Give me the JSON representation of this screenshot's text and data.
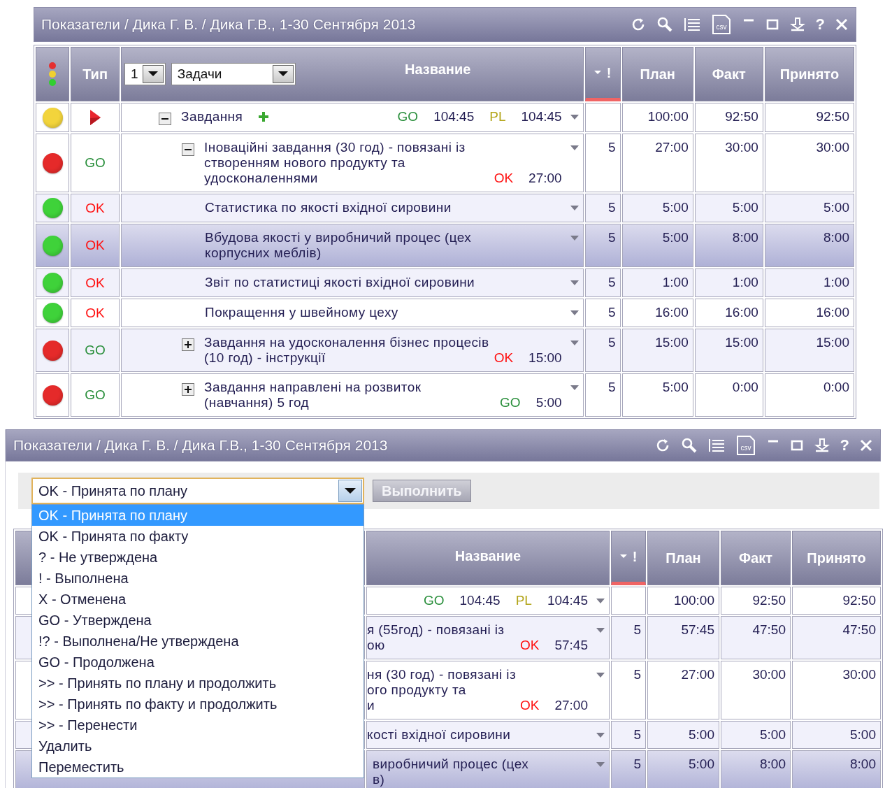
{
  "top_window": {
    "title": "Показатели / Дика Г. В. / Дика Г.В., 1-30 Сентября 2013",
    "toolbar": {
      "export_label": "csv",
      "help_label": "?"
    },
    "table": {
      "level_select": {
        "value": "1"
      },
      "group_select": {
        "value": "Задачи"
      },
      "columns": [
        {
          "kind": "status"
        },
        {
          "kind": "type",
          "label": "Тип"
        },
        {
          "kind": "name",
          "label": "Название"
        },
        {
          "kind": "flag",
          "label": "!",
          "sorted": true
        },
        {
          "kind": "number",
          "label": "План"
        },
        {
          "kind": "number",
          "label": "Факт"
        },
        {
          "kind": "number",
          "label": "Принято"
        }
      ],
      "rows": [
        {
          "color": "#f2d43c",
          "type": {
            "kind": "play"
          },
          "name_lines": [
            "Завдання"
          ],
          "expanded": true,
          "addable": true,
          "tags": [
            {
              "kind": "go",
              "text": "GO"
            },
            {
              "kind": "time",
              "text": "104:45"
            },
            {
              "kind": "pl",
              "text": "PL"
            },
            {
              "kind": "time",
              "text": "104:45"
            }
          ],
          "plan": "100:00",
          "fact": "92:50",
          "accepted": "92:50",
          "shaded": false,
          "selected": false,
          "children": [
            {
              "color": "#e52a2a",
              "type": {
                "kind": "go",
                "text": "GO"
              },
              "name_lines": [
                "Іноваційні завдання (30 год) - повязані із",
                "створенням нового продукту та",
                "удосконаленнями"
              ],
              "expanded": true,
              "tags": [
                {
                  "kind": "ok",
                  "text": "OK"
                },
                {
                  "kind": "time",
                  "text": "27:00"
                }
              ],
              "priority": "5",
              "plan": "27:00",
              "fact": "30:00",
              "accepted": "30:00",
              "shaded": false,
              "selected": false,
              "children": [
                {
                  "color": "#3fd23a",
                  "type": {
                    "kind": "ok",
                    "text": "OK"
                  },
                  "name_lines": [
                    "Статистика по якості вхідної сировини"
                  ],
                  "priority": "5",
                  "plan": "5:00",
                  "fact": "5:00",
                  "accepted": "5:00",
                  "shaded": true,
                  "selected": false
                },
                {
                  "color": "#3fd23a",
                  "type": {
                    "kind": "ok",
                    "text": "OK"
                  },
                  "name_lines": [
                    "Вбудова якості у виробничий процес (цех",
                    "корпусних меблів)"
                  ],
                  "priority": "5",
                  "plan": "5:00",
                  "fact": "8:00",
                  "accepted": "8:00",
                  "selected": true
                },
                {
                  "color": "#3fd23a",
                  "type": {
                    "kind": "ok",
                    "text": "OK"
                  },
                  "name_lines": [
                    "Звіт по статистиці якості вхідної сировини"
                  ],
                  "priority": "5",
                  "plan": "1:00",
                  "fact": "1:00",
                  "accepted": "1:00",
                  "shaded": true,
                  "selected": false
                },
                {
                  "color": "#3fd23a",
                  "type": {
                    "kind": "ok",
                    "text": "OK"
                  },
                  "name_lines": [
                    "Покращення у швейному цеху"
                  ],
                  "priority": "5",
                  "plan": "16:00",
                  "fact": "16:00",
                  "accepted": "16:00",
                  "shaded": false,
                  "selected": false
                }
              ]
            },
            {
              "color": "#e52a2a",
              "type": {
                "kind": "go",
                "text": "GO"
              },
              "name_lines": [
                "Завдання на удосконалення бізнес процесів",
                "(10 год) - інструкції"
              ],
              "expanded": false,
              "tags": [
                {
                  "kind": "ok",
                  "text": "OK"
                },
                {
                  "kind": "time",
                  "text": "15:00"
                }
              ],
              "priority": "5",
              "plan": "15:00",
              "fact": "15:00",
              "accepted": "15:00",
              "shaded": true,
              "selected": false
            },
            {
              "color": "#e52a2a",
              "type": {
                "kind": "go",
                "text": "GO"
              },
              "name_lines": [
                "Завдання направлені на розвиток",
                "(навчання) 5 год"
              ],
              "expanded": false,
              "tags": [
                {
                  "kind": "go",
                  "text": "GO"
                },
                {
                  "kind": "time",
                  "text": "5:00"
                }
              ],
              "priority": "5",
              "plan": "5:00",
              "fact": "0:00",
              "accepted": "0:00",
              "shaded": false,
              "selected": false
            }
          ]
        }
      ]
    }
  },
  "bottom_window": {
    "title": "Показатели / Дика Г. В. / Дика Г.В., 1-30 Сентября 2013",
    "toolbar": {
      "export_label": "csv",
      "help_label": "?"
    },
    "action_select": {
      "value": "OK - Принята по плану",
      "open": true
    },
    "execute_button": {
      "label": "Выполнить",
      "disabled": true
    },
    "options": [
      {
        "label": "OK - Принята по плану",
        "selected": true
      },
      {
        "label": "OK - Принята по факту",
        "selected": false
      },
      {
        "label": "? - Не утверждена",
        "selected": false
      },
      {
        "label": "! - Выполнена",
        "selected": false
      },
      {
        "label": "X - Отменена",
        "selected": false
      },
      {
        "label": "GO - Утверждена",
        "selected": false
      },
      {
        "label": "!? - Выполнена/Не утверждена",
        "selected": false
      },
      {
        "label": "GO - Продолжена",
        "selected": false
      },
      {
        "label": ">> - Принять по плану и продолжить",
        "selected": false
      },
      {
        "label": ">> - Принять по факту и продолжить",
        "selected": false
      },
      {
        "label": ">> - Перенести",
        "selected": false
      },
      {
        "label": "Удалить",
        "selected": false
      },
      {
        "label": "Переместить",
        "selected": false
      }
    ],
    "table": {
      "columns": [
        {
          "kind": "name",
          "label": "Название"
        },
        {
          "kind": "flag",
          "label": "!",
          "sorted": true
        },
        {
          "kind": "number",
          "label": "План"
        },
        {
          "kind": "number",
          "label": "Факт"
        },
        {
          "kind": "number",
          "label": "Принято"
        }
      ],
      "rows": [
        {
          "lines": [],
          "tags": [
            {
              "kind": "go",
              "text": "GO"
            },
            {
              "kind": "time",
              "text": "104:45"
            },
            {
              "kind": "pl",
              "text": "PL"
            },
            {
              "kind": "time",
              "text": "104:45"
            }
          ],
          "plan": "100:00",
          "fact": "92:50",
          "accepted": "92:50",
          "shaded": false,
          "selected": false
        },
        {
          "lines": [
            "я (55год) - повязані із",
            "ою"
          ],
          "tags": [
            {
              "kind": "ok",
              "text": "OK"
            },
            {
              "kind": "time",
              "text": "57:45"
            }
          ],
          "priority": "5",
          "plan": "57:45",
          "fact": "47:50",
          "accepted": "47:50",
          "shaded": true,
          "selected": false
        },
        {
          "lines": [
            "ня (30 год) - повязані із",
            "ого продукту та",
            "и"
          ],
          "tags": [
            {
              "kind": "ok",
              "text": "OK"
            },
            {
              "kind": "time",
              "text": "27:00"
            }
          ],
          "priority": "5",
          "plan": "27:00",
          "fact": "30:00",
          "accepted": "30:00",
          "shaded": false,
          "selected": false
        },
        {
          "lines": [
            "кості вхідної сировини"
          ],
          "tags": [],
          "priority": "5",
          "plan": "5:00",
          "fact": "5:00",
          "accepted": "5:00",
          "shaded": true,
          "selected": false
        },
        {
          "lines": [
            "виробничий процес (цех",
            "в)"
          ],
          "tags": [],
          "priority": "5",
          "plan": "5:00",
          "fact": "8:00",
          "accepted": "8:00",
          "selected": true
        }
      ]
    }
  }
}
